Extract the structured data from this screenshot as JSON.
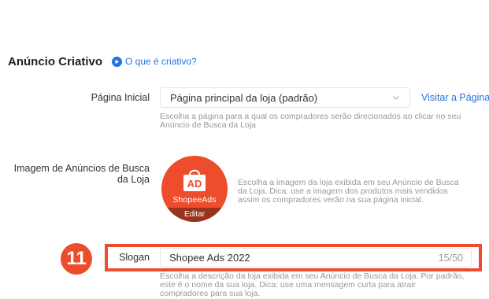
{
  "section": {
    "title": "Anúncio Criativo",
    "help_link": "O que é criativo?"
  },
  "landing_page": {
    "label": "Página Inicial",
    "selected_value": "Página principal da loja (padrão)",
    "visit_link": "Visitar a Página",
    "hint_lines": [
      "Escolha a página para a qual os compradores serão direcionados ao clicar no seu",
      "Anúncio de Busca da Loja"
    ]
  },
  "ad_image": {
    "label_lines": [
      "Imagem de Anúncios de Busca",
      "da Loja"
    ],
    "brand_text": "ShopeeAds",
    "bag_text": "AD",
    "edit_label": "Editar",
    "hint_lines": [
      "Escolha a imagem da loja exibida em seu Anúncio de Busca",
      "da Loja. Dica: use a imagem dos produtos mais vendidos",
      "assim os compradores verão na sua página inicial."
    ]
  },
  "slogan": {
    "step_number": "11",
    "label": "Slogan",
    "value": "Shopee Ads 2022",
    "char_count": "15/50",
    "hint_lines": [
      "Escolha a descrição da loja exibida em seu Anúncio de Busca da Loja. Por padrão,",
      "este é o nome da sua loja. Dica: use uma mensagem curta para atrair",
      "compradores para sua loja."
    ]
  },
  "colors": {
    "accent_blue": "#2673dd",
    "brand_orange": "#ee4d2d",
    "hint_gray": "#999999"
  },
  "icons": {
    "help": "play-circle-icon",
    "dropdown": "chevron-down-icon",
    "ad_bag": "shopping-bag-icon"
  }
}
